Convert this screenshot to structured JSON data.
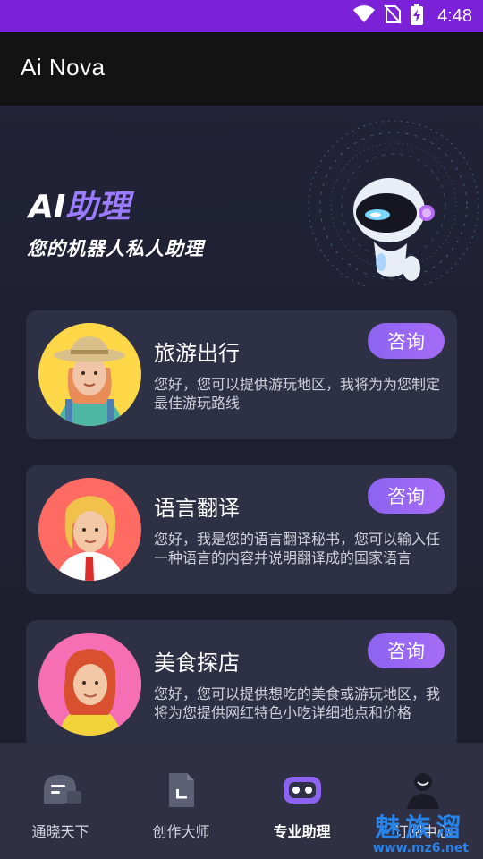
{
  "status_bar": {
    "time": "4:48",
    "icons": [
      "wifi-icon",
      "no-sim-icon",
      "battery-charging-icon"
    ],
    "color": "#7b22d9"
  },
  "app_bar": {
    "title": "Ai Nova"
  },
  "hero": {
    "title_prefix": "AI",
    "title_accent": "助理",
    "subtitle": "您的机器人私人助理"
  },
  "cards": [
    {
      "title": "旅游出行",
      "description": "您好，您可以提供游玩地区，我将为为您制定最佳游玩路线",
      "button": "咨询",
      "avatar": "traveler-avatar"
    },
    {
      "title": "语言翻译",
      "description": "您好，我是您的语言翻译秘书，您可以输入任一种语言的内容并说明翻译成的国家语言",
      "button": "咨询",
      "avatar": "translator-avatar"
    },
    {
      "title": "美食探店",
      "description": "您好，您可以提供想吃的美食或游玩地区，我将为您提供网红特色小吃详细地点和价格",
      "button": "咨询",
      "avatar": "food-explorer-avatar"
    }
  ],
  "nav": {
    "items": [
      {
        "label": "通晓天下",
        "icon": "chat-bubble-icon",
        "active": false
      },
      {
        "label": "创作大师",
        "icon": "document-icon",
        "active": false
      },
      {
        "label": "专业助理",
        "icon": "robot-icon",
        "active": true
      },
      {
        "label": "订阅中心",
        "icon": "user-icon",
        "active": false
      }
    ]
  },
  "watermark": {
    "text": "魅族溜",
    "url": "www.mz6.net"
  },
  "colors": {
    "accent": "#9b7bff",
    "button": "#8c63f0",
    "card": "#2e3045",
    "nav": "#2f3044"
  }
}
